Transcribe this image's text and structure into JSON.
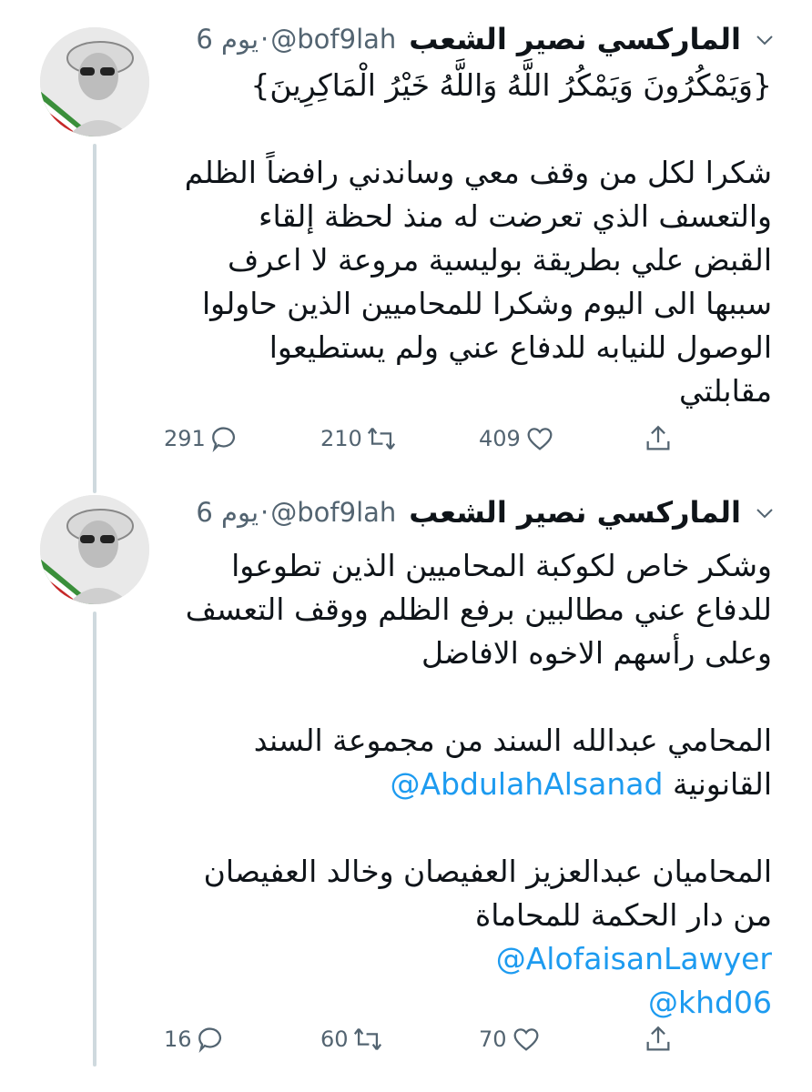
{
  "tweets": [
    {
      "name": "الماركسي نصير الشعب",
      "handle": "@bof9lah",
      "separator": "·",
      "time": "6 يوم",
      "body": [
        "{وَيَمْكُرُونَ وَيَمْكُرُ اللَّهُ وَاللَّهُ خَيْرُ الْمَاكِرِينَ}",
        "",
        "شكرا لكل من وقف معي وساندني رافضاً الظلم والتعسف الذي تعرضت له منذ لحظة إلقاء القبض علي بطريقة بوليسية مروعة لا اعرف سببها الى اليوم وشكرا للمحاميين الذين حاولوا الوصول للنيابه للدفاع عني ولم يستطيعوا مقابلتي"
      ],
      "replies": "291",
      "retweets": "210",
      "likes": "409"
    },
    {
      "name": "الماركسي نصير الشعب",
      "handle": "@bof9lah",
      "separator": "·",
      "time": "6 يوم",
      "body_p1": "وشكر خاص لكوكبة المحاميين الذين تطوعوا للدفاع عني مطالبين برفع الظلم ووقف التعسف وعلى رأسهم الاخوه الافاضل",
      "body_p2": "المحامي عبدالله السند من مجموعة السند القانونية",
      "mention1": "@AbdulahAlsanad",
      "body_p3": "المحاميان عبدالعزيز العفيصان  وخالد العفيصان من دار الحكمة للمحاماة",
      "mention2": "@AlofaisanLawyer",
      "mention3": "@khd06",
      "replies": "16",
      "retweets": "60",
      "likes": "70"
    }
  ],
  "colors": {
    "accent": "#1d9bf0",
    "muted": "#536471",
    "line": "#cfd9de"
  },
  "icons": [
    "reply-icon",
    "retweet-icon",
    "like-icon",
    "share-icon",
    "caret-down-icon"
  ]
}
